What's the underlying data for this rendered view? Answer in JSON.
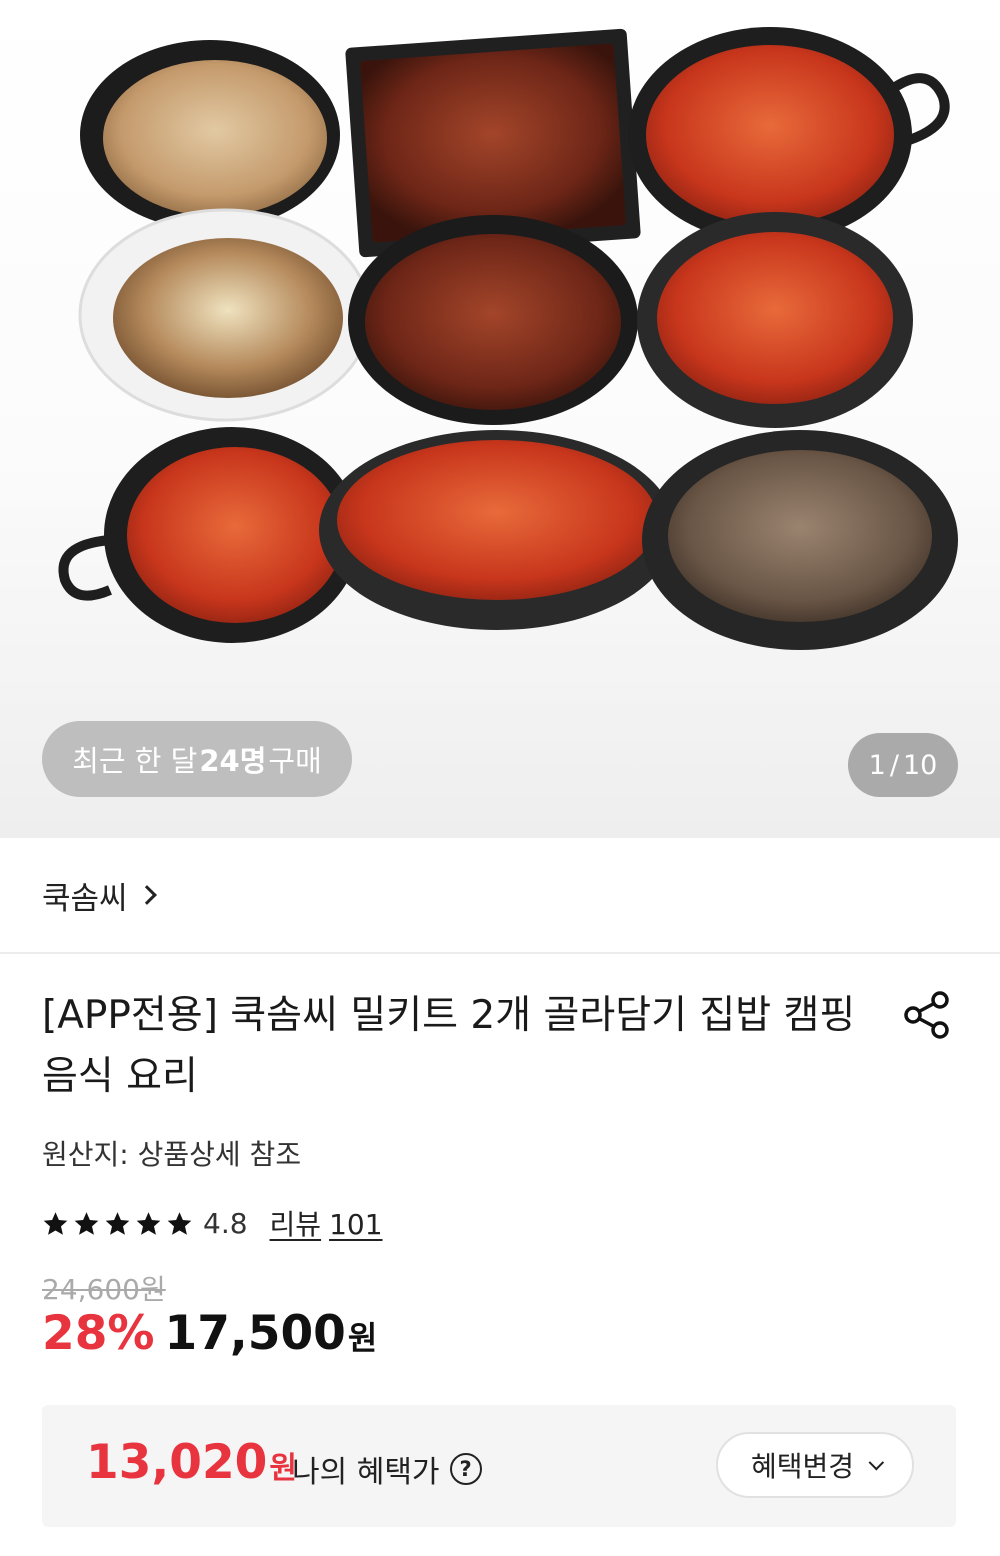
{
  "hero": {
    "recent_prefix": "최근 한 달",
    "recent_count": "24명",
    "recent_suffix": "구매",
    "pager_current": "1",
    "pager_sep": "/",
    "pager_total": "10"
  },
  "store": {
    "name": "쿡솜씨"
  },
  "product": {
    "title": "[APP전용] 쿡솜씨 밀키트 2개 골라담기 집밥 캠핑 음식 요리",
    "origin": "원산지: 상품상세 참조",
    "rating": "4.8",
    "stars": 5,
    "review_label": "리뷰",
    "review_count": "101"
  },
  "price": {
    "original": "24,600원",
    "discount": "28%",
    "sale": "17,500",
    "won": "원"
  },
  "benefit": {
    "price": "13,020",
    "won": "원",
    "label": "나의 혜택가",
    "help": "?",
    "change_label": "혜택변경"
  },
  "colors": {
    "accent": "#e8343f",
    "star": "#111111",
    "box_bg": "#f5f5f5"
  },
  "icons": [
    "chevron-right-icon",
    "share-icon",
    "star-icon",
    "help-icon",
    "chevron-down-icon"
  ]
}
